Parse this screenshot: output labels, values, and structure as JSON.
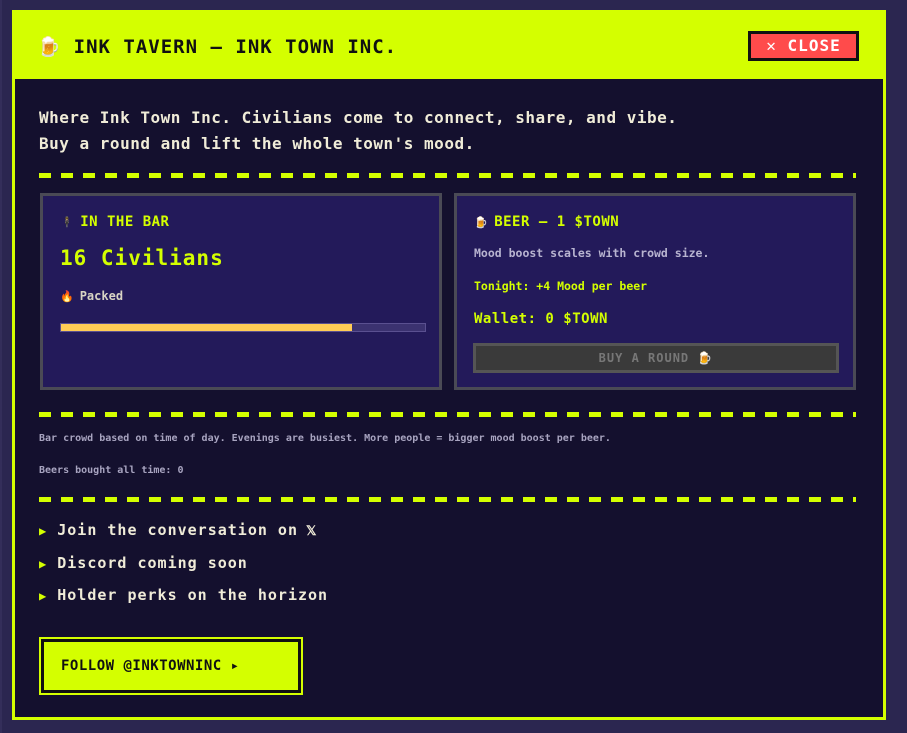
{
  "header": {
    "icon": "beer-mug-icon",
    "title": "INK TAVERN — INK TOWN INC.",
    "close_label": "✕ CLOSE"
  },
  "intro": {
    "line1": "Where Ink Town Inc. Civilians come to connect, share, and vibe.",
    "line2": "Buy a round and lift the whole town's mood."
  },
  "bar_card": {
    "icon": "figure-icon",
    "heading": "IN THE BAR",
    "count": "16 Civilians",
    "status_icon": "flame-icon",
    "status": "Packed",
    "crowd_level": 0.8
  },
  "beer_card": {
    "icon": "beer-mug-icon",
    "heading": "BEER — 1 $TOWN",
    "description": "Mood boost scales with crowd size.",
    "tonight": "Tonight: +4 Mood per beer",
    "wallet": "Wallet: 0 $TOWN",
    "buy_label": "BUY A ROUND 🍺"
  },
  "notes": {
    "crowd_info": "Bar crowd based on time of day. Evenings are busiest. More people = bigger mood boost per beer.",
    "beers_total": "Beers bought all time: 0"
  },
  "links": [
    {
      "label": "Join the conversation on",
      "suffix": "𝕏"
    },
    {
      "label": "Discord coming soon",
      "suffix": ""
    },
    {
      "label": "Holder perks on the horizon",
      "suffix": ""
    }
  ],
  "follow": {
    "label": "FOLLOW @INKTOWNINC ▸"
  },
  "colors": {
    "accent": "#d4ff00",
    "panel": "#14102e",
    "card": "#231a5a",
    "close": "#ff4b4b",
    "crowd_bar": "#ffcc55"
  }
}
